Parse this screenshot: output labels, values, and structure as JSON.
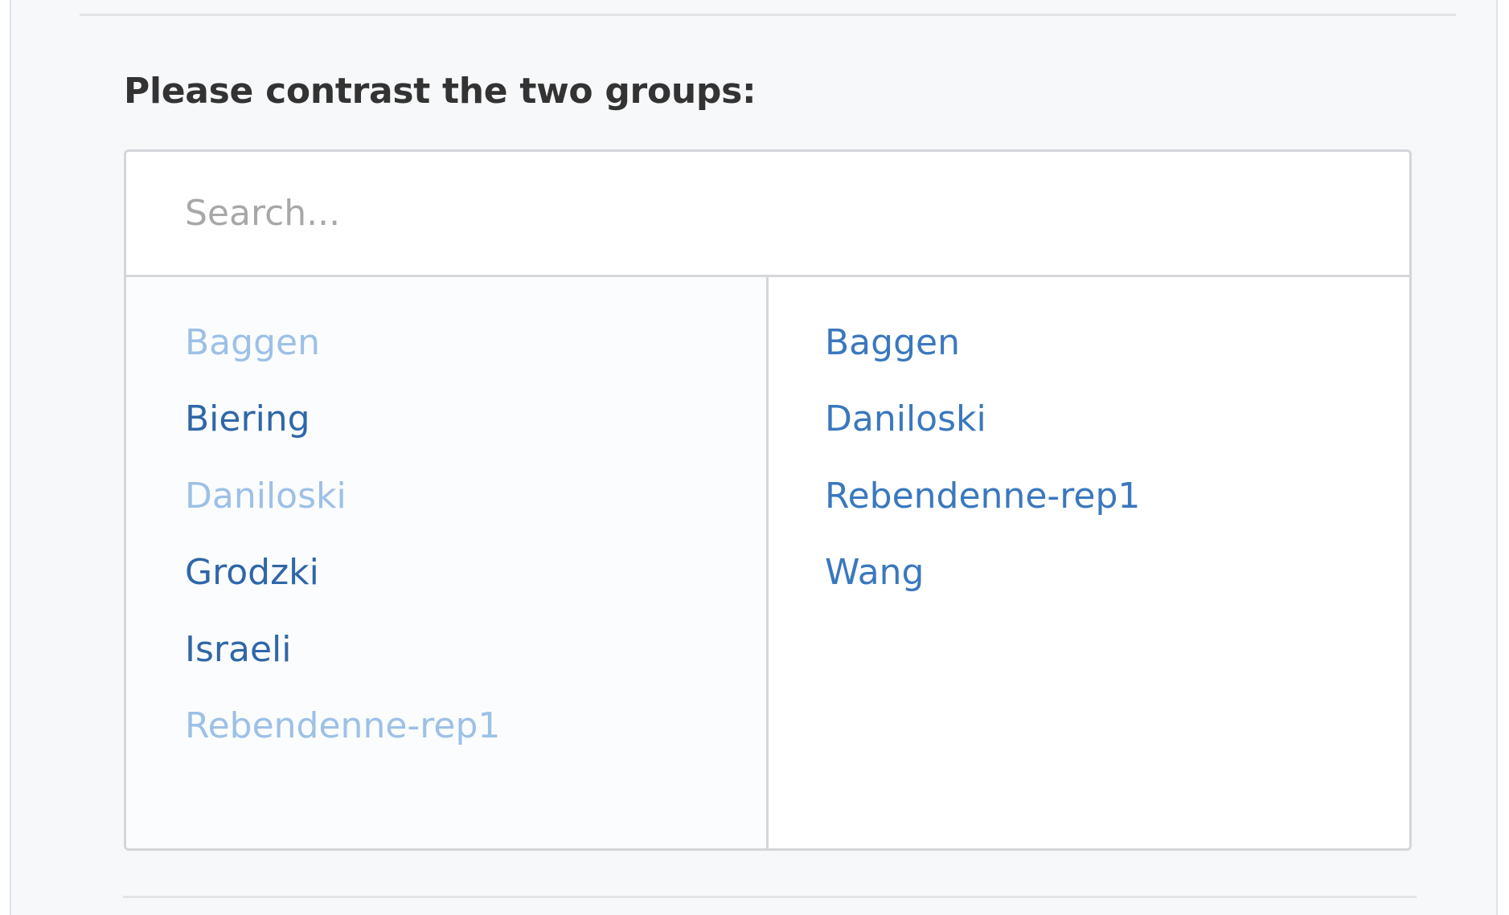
{
  "form": {
    "prompt": "Please contrast the two groups:"
  },
  "search": {
    "placeholder": "Search..."
  },
  "left_column": {
    "items": [
      {
        "label": "Baggen",
        "state": "disabled"
      },
      {
        "label": "Biering",
        "state": "available"
      },
      {
        "label": "Daniloski",
        "state": "disabled"
      },
      {
        "label": "Grodzki",
        "state": "available"
      },
      {
        "label": "Israeli",
        "state": "available"
      },
      {
        "label": "Rebendenne-rep1",
        "state": "disabled"
      }
    ]
  },
  "right_column": {
    "items": [
      {
        "label": "Baggen"
      },
      {
        "label": "Daniloski"
      },
      {
        "label": "Rebendenne-rep1"
      },
      {
        "label": "Wang"
      }
    ]
  },
  "colors": {
    "link": "#3a78be",
    "link_disabled": "#9dc0e7",
    "border": "#d4d6da",
    "panel_bg": "#f7f8fa"
  }
}
